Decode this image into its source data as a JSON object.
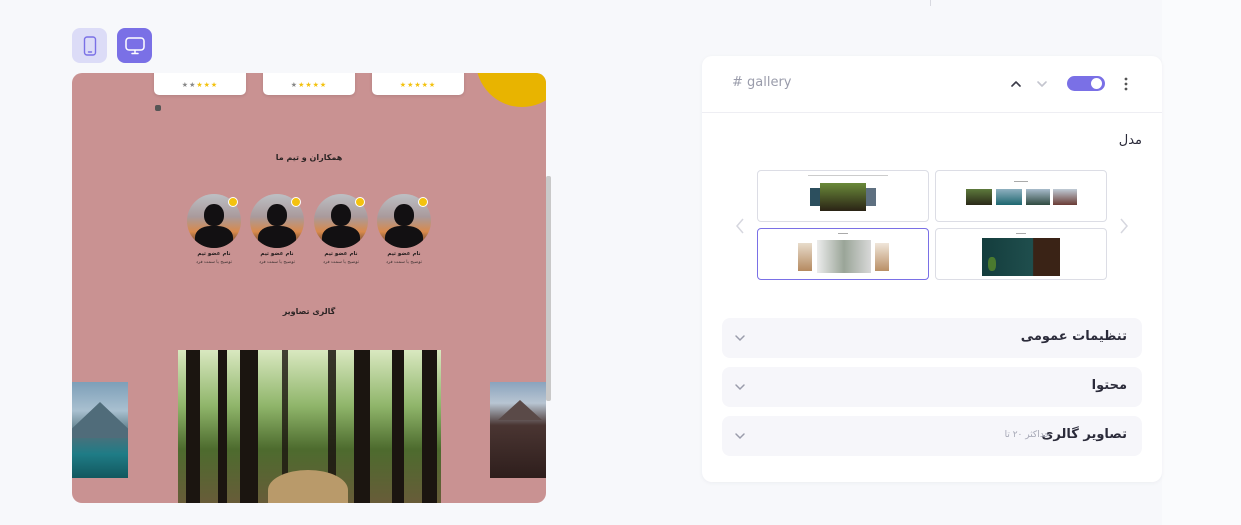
{
  "devices": {
    "mobile_icon": "mobile-icon",
    "desktop_icon": "desktop-icon",
    "active": "desktop"
  },
  "preview": {
    "ratings": [
      "★★★★★",
      "★★★★★",
      "★★★★★"
    ],
    "team_title": "همکاران و تیم ما",
    "members": [
      {
        "name": "نام عضو تیم",
        "role": "توضیح یا سمت فرد"
      },
      {
        "name": "نام عضو تیم",
        "role": "توضیح یا سمت فرد"
      },
      {
        "name": "نام عضو تیم",
        "role": "توضیح یا سمت فرد"
      },
      {
        "name": "نام عضو تیم",
        "role": "توضیح یا سمت فرد"
      }
    ],
    "gallery_title": "گالری تصاویر"
  },
  "panel": {
    "id_label": "# gallery",
    "enabled": true,
    "model_label": "مدل",
    "models": [
      "gallery-model-1",
      "gallery-model-2",
      "gallery-model-3",
      "gallery-model-4"
    ],
    "selected_model": 3,
    "accordions": [
      {
        "title": "تنظیمات عمومی",
        "sub": ""
      },
      {
        "title": "محتوا",
        "sub": ""
      },
      {
        "title": "تصاویر گالری",
        "sub": "حداکثر ۲۰ تا"
      }
    ]
  },
  "colors": {
    "accent": "#7a70e6",
    "preview_bg": "#c99292",
    "star": "#f3c20f"
  }
}
